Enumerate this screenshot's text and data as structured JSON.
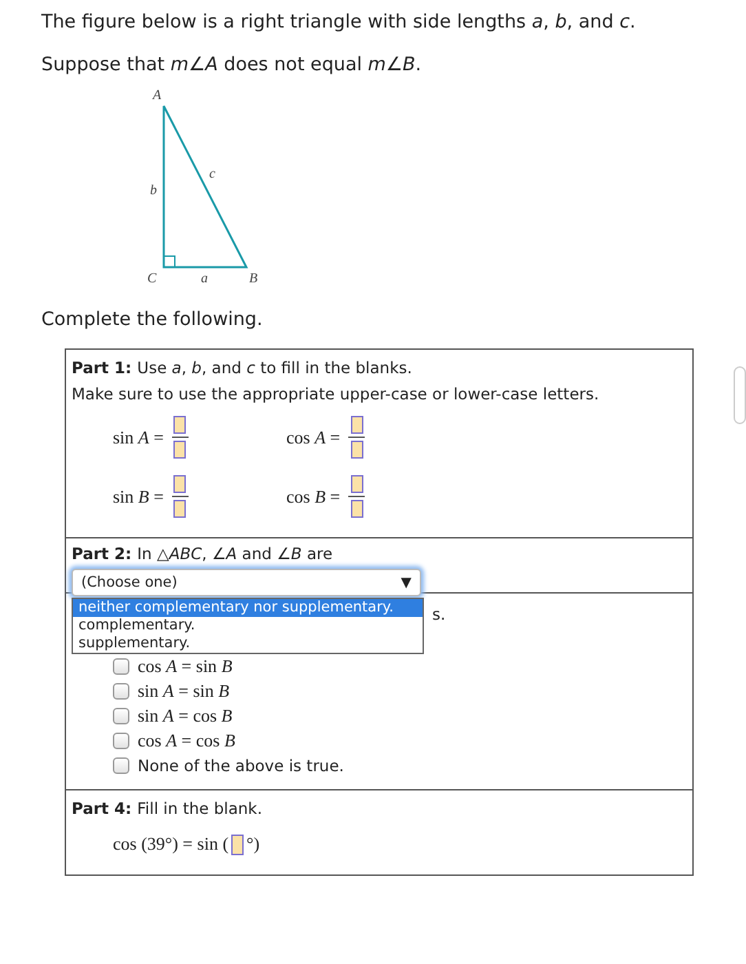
{
  "intro": [
    "The figure below is a right triangle with side lengths *a*, *b*, and *c*.",
    "Suppose that *m∠A* does not equal *m∠B*."
  ],
  "figure": {
    "labels": {
      "A": "A",
      "B": "B",
      "C": "C",
      "a": "a",
      "b": "b",
      "c": "c"
    }
  },
  "instruction": "Complete the following.",
  "part_1": {
    "heading": "Part 1:",
    "text": "Use *a*, *b*, and *c* to fill in the blanks.",
    "note": "Make sure to use the appropriate upper-case or lower-case letters.",
    "equations": [
      {
        "lhs": "sin *A* ="
      },
      {
        "lhs": "cos *A* ="
      },
      {
        "lhs": "sin *B* ="
      },
      {
        "lhs": "cos *B* ="
      }
    ]
  },
  "part_2": {
    "heading": "Part 2:",
    "text": "In △*ABC*, ∠*A* and ∠*B* are",
    "dropdown": {
      "value": "(Choose one)",
      "arrow": "▼",
      "expanded": true,
      "options": [
        {
          "label": "neither complementary nor supplementary.",
          "selected": true
        },
        {
          "label": "complementary.",
          "selected": false
        },
        {
          "label": "supplementary.",
          "selected": false
        }
      ]
    }
  },
  "part_3": {
    "heading_tail": "s.",
    "options": [
      {
        "label": "cos *A* = sin *B*",
        "checked": false
      },
      {
        "label": "sin *A* = sin *B*",
        "checked": false
      },
      {
        "label": "sin *A* = cos *B*",
        "checked": false
      },
      {
        "label": "cos *A* = cos *B*",
        "checked": false
      },
      {
        "label": "None of the above is true.",
        "checked": false,
        "kind": "text"
      }
    ]
  },
  "part_4": {
    "heading": "Part 4:",
    "text": "Fill in the blank.",
    "prefix": "cos (39°) = sin (",
    "suffix": "°)"
  }
}
